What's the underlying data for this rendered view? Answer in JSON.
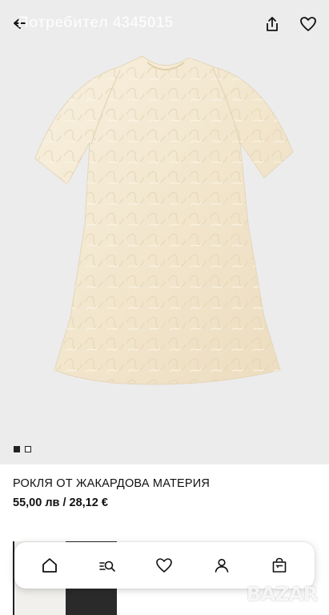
{
  "header": {
    "title": "Потребител 4345015"
  },
  "gallery": {
    "image_count": 2,
    "active_index": 0
  },
  "product": {
    "name": "РОКЛЯ ОТ ЖАКАРДОВА МАТЕРИЯ",
    "price": "55,00 лв / 28,12 €"
  },
  "icons": {
    "back": "back-arrow-icon",
    "share": "share-icon",
    "favorite": "heart-icon",
    "nav": [
      "home-icon",
      "search-icon",
      "heart-icon",
      "profile-icon",
      "bag-icon"
    ]
  },
  "watermark": {
    "text": "BAZAR"
  },
  "colors": {
    "hero_background": "#ececec",
    "dress": "#f4ead6",
    "text": "#111111"
  }
}
